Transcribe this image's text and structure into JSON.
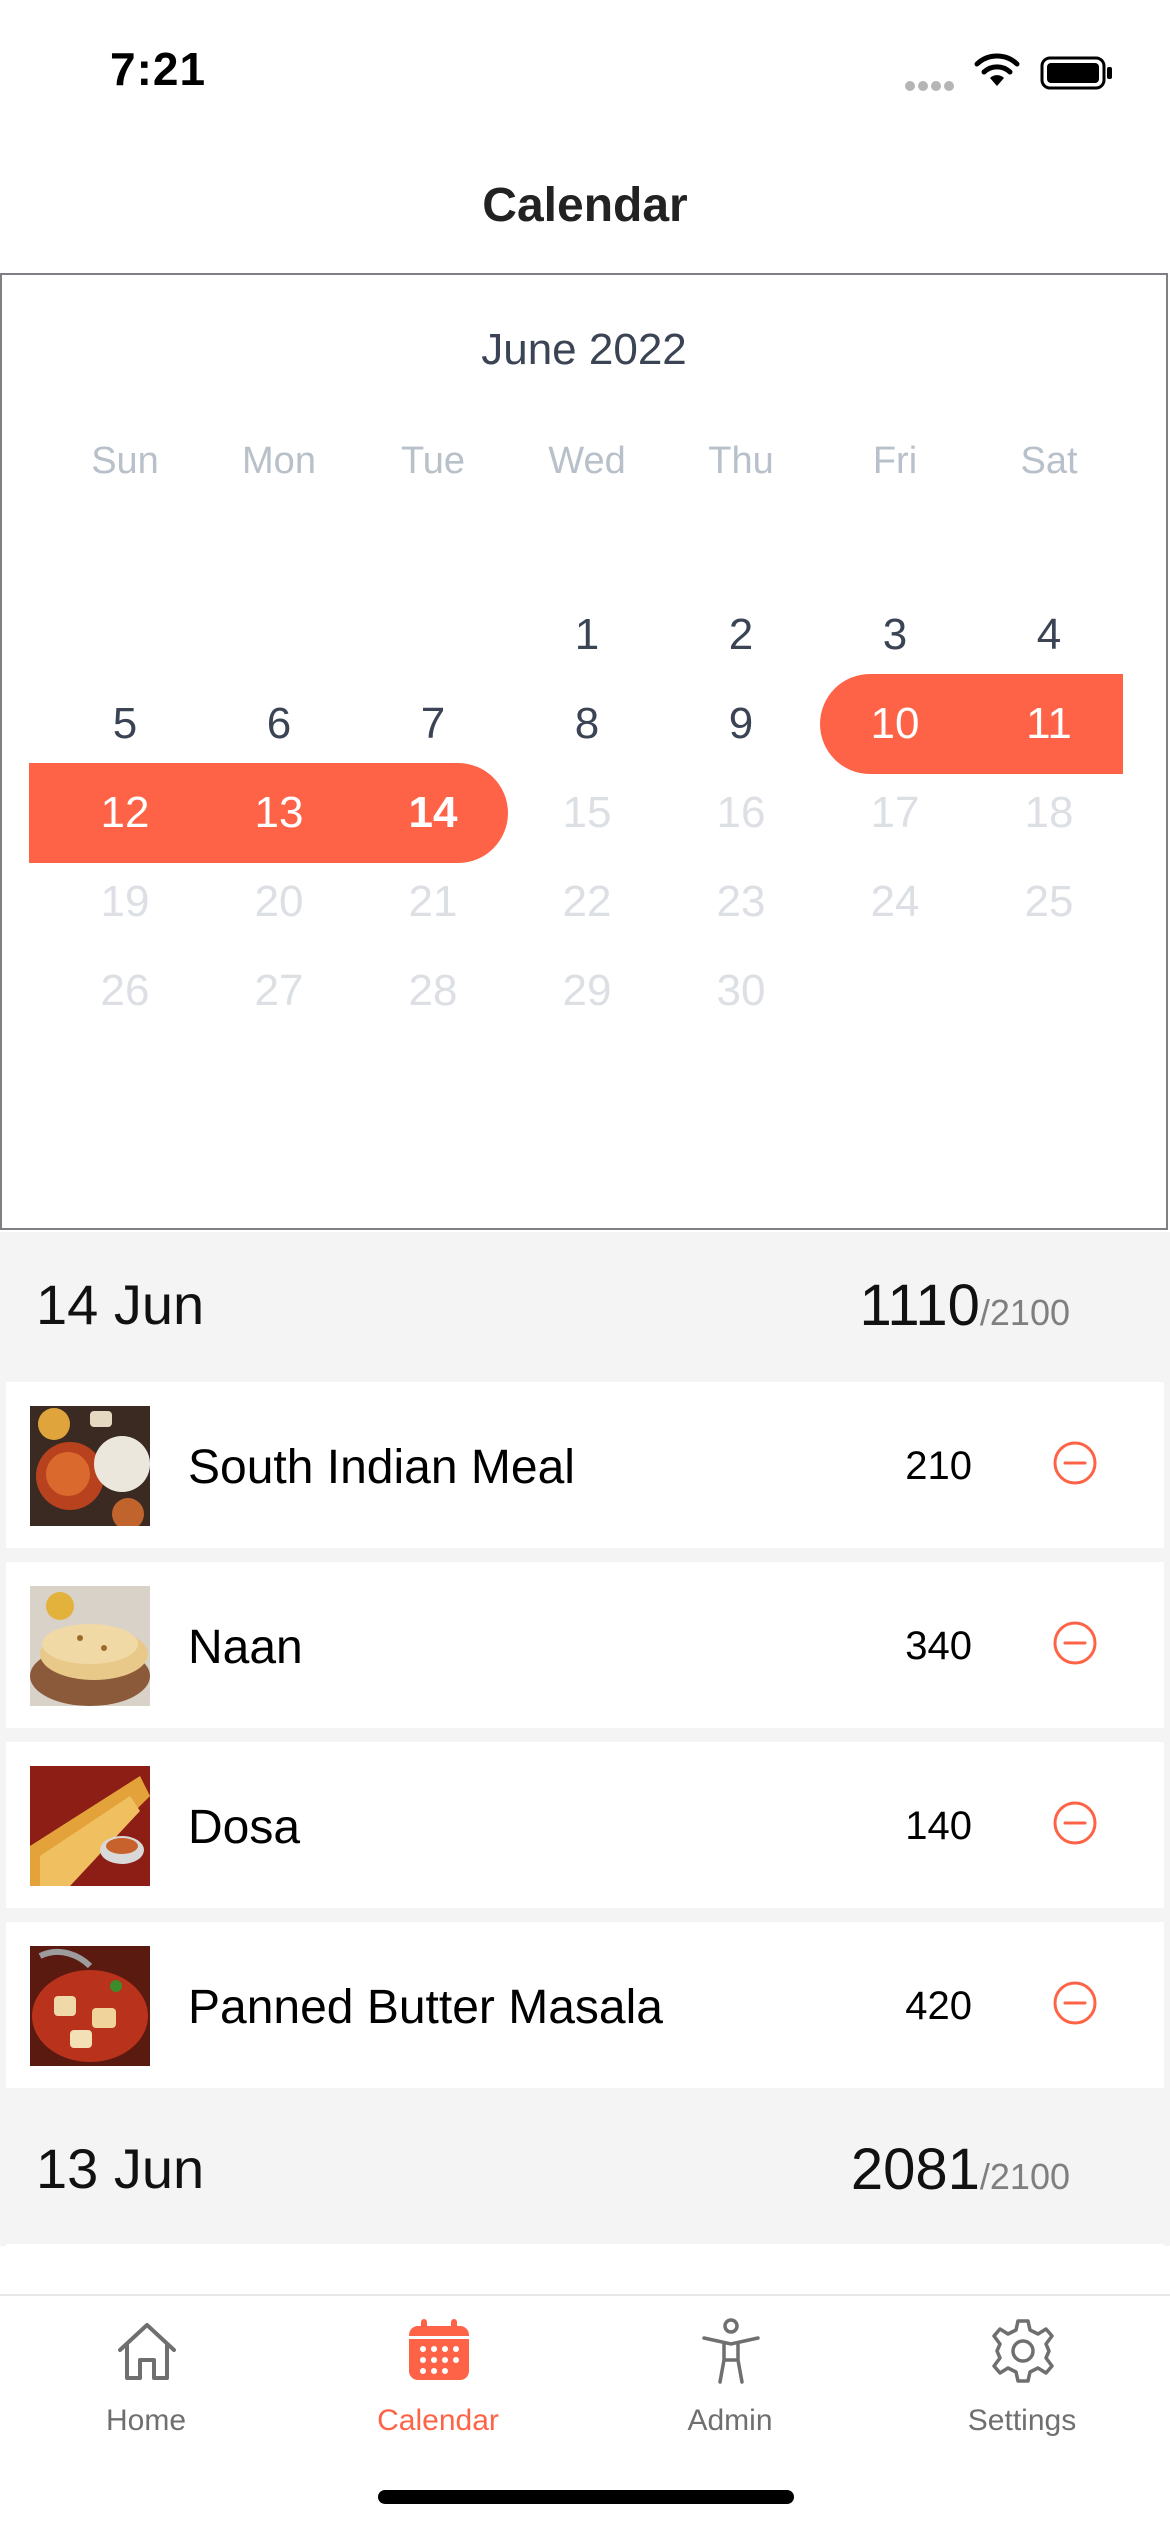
{
  "status": {
    "time": "7:21"
  },
  "header": {
    "title": "Calendar"
  },
  "calendar": {
    "month": "June 2022",
    "weekdays": [
      "Sun",
      "Mon",
      "Tue",
      "Wed",
      "Thu",
      "Fri",
      "Sat"
    ],
    "first_weekday_index": 3,
    "days": [
      "1",
      "2",
      "3",
      "4",
      "5",
      "6",
      "7",
      "8",
      "9",
      "10",
      "11",
      "12",
      "13",
      "14",
      "15",
      "16",
      "17",
      "18",
      "19",
      "20",
      "21",
      "22",
      "23",
      "24",
      "25",
      "26",
      "27",
      "28",
      "29",
      "30"
    ],
    "last_enabled_day": 14,
    "selected_range": [
      10,
      14
    ],
    "selected_day": 14,
    "accent": "#ff6347"
  },
  "sections": [
    {
      "date": "14 Jun",
      "total": "1110",
      "goal": "/2100",
      "items": [
        {
          "name": "South Indian Meal",
          "calories": "210",
          "icon": "minus-circle-icon"
        },
        {
          "name": "Naan",
          "calories": "340",
          "icon": "minus-circle-icon"
        },
        {
          "name": "Dosa",
          "calories": "140",
          "icon": "minus-circle-icon"
        },
        {
          "name": "Panned Butter Masala",
          "calories": "420",
          "icon": "minus-circle-icon"
        }
      ]
    },
    {
      "date": "13 Jun",
      "total": "2081",
      "goal": "/2100",
      "items": []
    }
  ],
  "tabs": [
    {
      "label": "Home",
      "icon": "home-icon",
      "active": false
    },
    {
      "label": "Calendar",
      "icon": "calendar-icon",
      "active": true
    },
    {
      "label": "Admin",
      "icon": "person-icon",
      "active": false
    },
    {
      "label": "Settings",
      "icon": "gear-icon",
      "active": false
    }
  ],
  "colors": {
    "accent": "#ff6347",
    "inactive_tab": "#6f6f6f",
    "section_bg": "#f4f4f4"
  }
}
